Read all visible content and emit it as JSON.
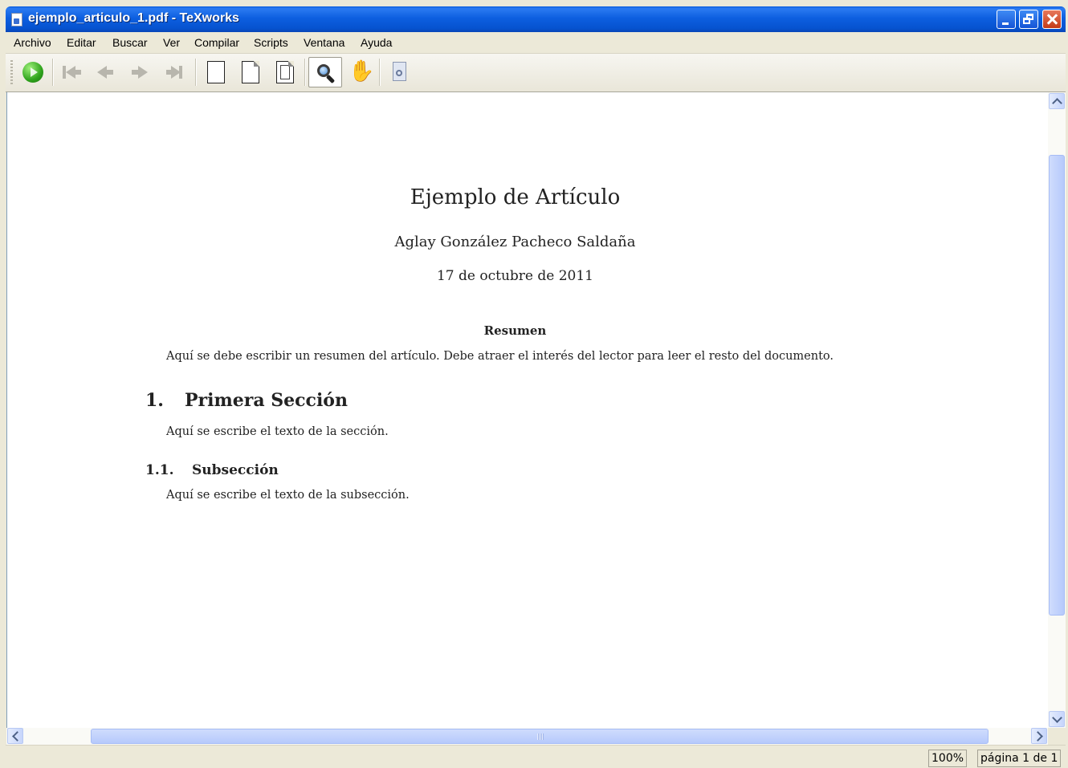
{
  "window": {
    "title": "ejemplo_articulo_1.pdf - TeXworks"
  },
  "menu": [
    "Archivo",
    "Editar",
    "Buscar",
    "Ver",
    "Compilar",
    "Scripts",
    "Ventana",
    "Ayuda"
  ],
  "toolbar": {
    "icons": [
      "play-icon",
      "first-page-icon",
      "previous-page-icon",
      "next-page-icon",
      "last-page-icon",
      "actual-size-icon",
      "fit-width-icon",
      "fit-page-icon",
      "magnify-icon",
      "hand-icon",
      "preview-icon"
    ],
    "active_tool": "magnify",
    "hand_glyph": "✋"
  },
  "document": {
    "title": "Ejemplo de Artículo",
    "author": "Aglay González Pacheco Saldaña",
    "date": "17 de octubre de 2011",
    "abstract_heading": "Resumen",
    "abstract_text": "Aquí se debe escribir un resumen del artículo. Debe atraer el interés del lector para leer el resto del documento.",
    "section": {
      "number": "1.",
      "title": "Primera Sección",
      "text": "Aquí se escribe el texto de la sección."
    },
    "subsection": {
      "number": "1.1.",
      "title": "Subsección",
      "text": "Aquí se escribe el texto de la subsección."
    }
  },
  "status": {
    "zoom": "100%",
    "page": "página 1 de 1"
  },
  "colors": {
    "titlebar": "#0653d0",
    "play_button": "#2fa31c",
    "scroll_thumb": "#b6c9fb"
  }
}
